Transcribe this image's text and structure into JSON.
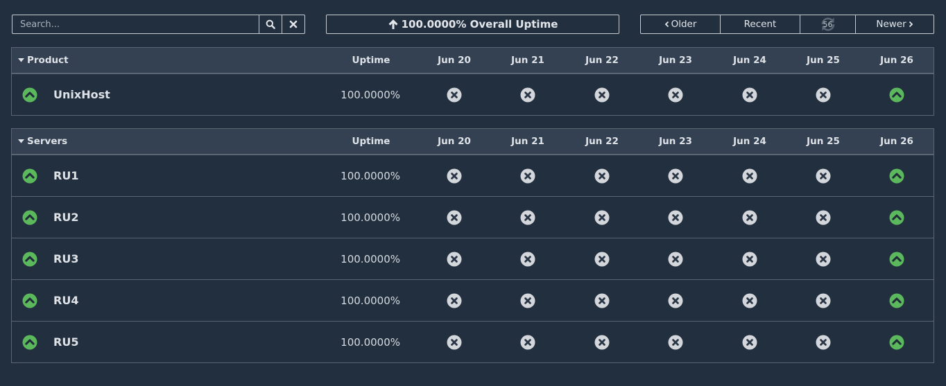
{
  "search": {
    "placeholder": "Search..."
  },
  "overall": {
    "label": "100.0000% Overall Uptime"
  },
  "nav": {
    "older": "Older",
    "recent": "Recent",
    "refresh_count": "56",
    "newer": "Newer"
  },
  "colors": {
    "up": "#5cb85c",
    "na": "#d3d6da",
    "background": "#222f3e",
    "header": "#334152"
  },
  "columns": {
    "uptime": "Uptime",
    "days": [
      "Jun 20",
      "Jun 21",
      "Jun 22",
      "Jun 23",
      "Jun 24",
      "Jun 25",
      "Jun 26"
    ]
  },
  "groups": [
    {
      "title": "Product",
      "rows": [
        {
          "name": "UnixHost",
          "uptime": "100.0000%",
          "status": "up",
          "days": [
            "na",
            "na",
            "na",
            "na",
            "na",
            "na",
            "up"
          ]
        }
      ]
    },
    {
      "title": "Servers",
      "rows": [
        {
          "name": "RU1",
          "uptime": "100.0000%",
          "status": "up",
          "days": [
            "na",
            "na",
            "na",
            "na",
            "na",
            "na",
            "up"
          ]
        },
        {
          "name": "RU2",
          "uptime": "100.0000%",
          "status": "up",
          "days": [
            "na",
            "na",
            "na",
            "na",
            "na",
            "na",
            "up"
          ]
        },
        {
          "name": "RU3",
          "uptime": "100.0000%",
          "status": "up",
          "days": [
            "na",
            "na",
            "na",
            "na",
            "na",
            "na",
            "up"
          ]
        },
        {
          "name": "RU4",
          "uptime": "100.0000%",
          "status": "up",
          "days": [
            "na",
            "na",
            "na",
            "na",
            "na",
            "na",
            "up"
          ]
        },
        {
          "name": "RU5",
          "uptime": "100.0000%",
          "status": "up",
          "days": [
            "na",
            "na",
            "na",
            "na",
            "na",
            "na",
            "up"
          ]
        }
      ]
    }
  ]
}
